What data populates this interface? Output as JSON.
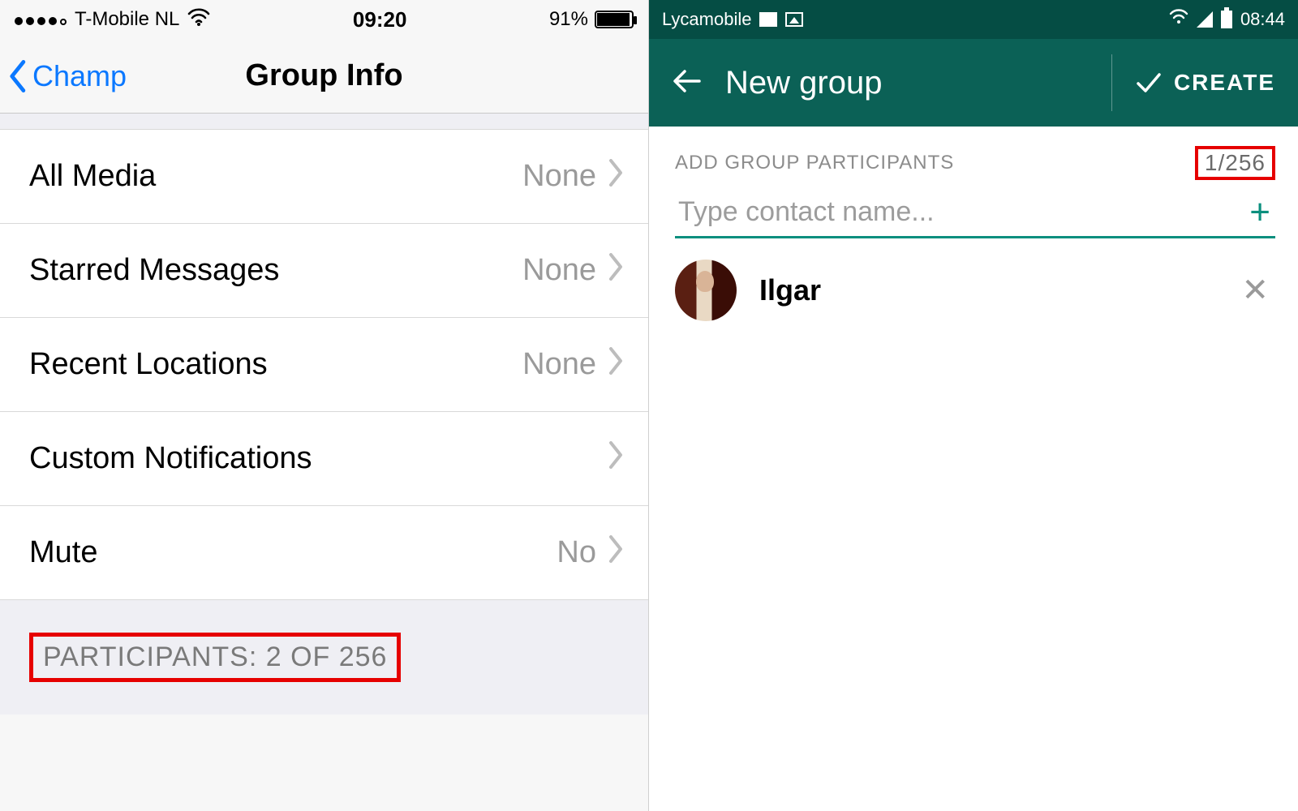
{
  "ios": {
    "status": {
      "carrier": "T-Mobile NL",
      "time": "09:20",
      "battery_pct": "91%"
    },
    "nav": {
      "back_label": "Champ",
      "title": "Group Info"
    },
    "rows": {
      "all_media": {
        "label": "All Media",
        "value": "None"
      },
      "starred": {
        "label": "Starred Messages",
        "value": "None"
      },
      "locations": {
        "label": "Recent Locations",
        "value": "None"
      },
      "notifications": {
        "label": "Custom Notifications",
        "value": ""
      },
      "mute": {
        "label": "Mute",
        "value": "No"
      }
    },
    "participants_header": "PARTICIPANTS: 2 OF 256"
  },
  "android": {
    "status": {
      "carrier": "Lycamobile",
      "time": "08:44"
    },
    "appbar": {
      "title": "New group",
      "create_label": "CREATE"
    },
    "subheader": "ADD GROUP PARTICIPANTS",
    "count": "1/256",
    "input_placeholder": "Type contact name...",
    "contact": {
      "name": "Ilgar"
    }
  },
  "colors": {
    "android_primary": "#0b6156",
    "ios_link": "#0b78ff",
    "highlight_box": "#e60000"
  }
}
